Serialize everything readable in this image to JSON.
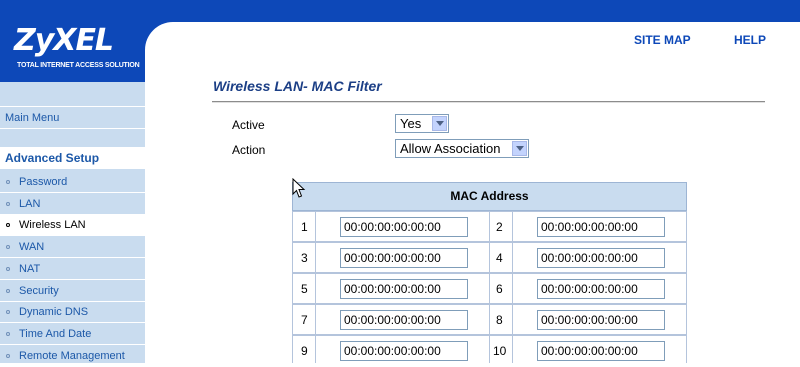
{
  "header": {
    "logo_main": "ZyXEL",
    "logo_sub": "TOTAL INTERNET ACCESS SOLUTION",
    "site_map": "SITE MAP",
    "help": "HELP",
    "brand_color": "#0d48b8"
  },
  "sidebar": {
    "main_menu": "Main Menu",
    "section": "Advanced Setup",
    "items": [
      {
        "label": "Password"
      },
      {
        "label": "LAN"
      },
      {
        "label": "Wireless LAN"
      },
      {
        "label": "WAN"
      },
      {
        "label": "NAT"
      },
      {
        "label": "Security"
      },
      {
        "label": "Dynamic DNS"
      },
      {
        "label": "Time And Date"
      },
      {
        "label": "Remote Management"
      }
    ],
    "active_item": "Wireless LAN",
    "bg_color": "#c9dcef"
  },
  "page": {
    "title": "Wireless LAN- MAC Filter",
    "active_label": "Active",
    "active_value": "Yes",
    "action_label": "Action",
    "action_value": "Allow Association"
  },
  "mac_table": {
    "header": "MAC Address",
    "rows": [
      {
        "n1": "1",
        "v1": "00:00:00:00:00:00",
        "n2": "2",
        "v2": "00:00:00:00:00:00"
      },
      {
        "n1": "3",
        "v1": "00:00:00:00:00:00",
        "n2": "4",
        "v2": "00:00:00:00:00:00"
      },
      {
        "n1": "5",
        "v1": "00:00:00:00:00:00",
        "n2": "6",
        "v2": "00:00:00:00:00:00"
      },
      {
        "n1": "7",
        "v1": "00:00:00:00:00:00",
        "n2": "8",
        "v2": "00:00:00:00:00:00"
      },
      {
        "n1": "9",
        "v1": "00:00:00:00:00:00",
        "n2": "10",
        "v2": "00:00:00:00:00:00"
      }
    ]
  }
}
